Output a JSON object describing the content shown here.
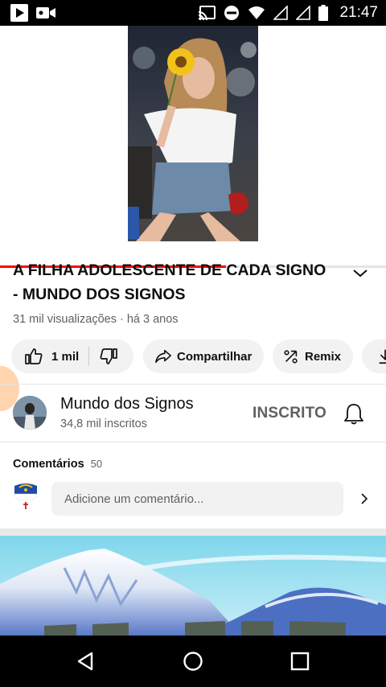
{
  "status_bar": {
    "time": "21:47",
    "left_icons": [
      "youtube-play-icon",
      "video-camera-icon"
    ],
    "right_icons": [
      "cast-icon",
      "do-not-disturb-icon",
      "wifi-icon",
      "signal-icon",
      "signal-icon",
      "battery-icon"
    ]
  },
  "video": {
    "progress_fraction": 0.585
  },
  "title": {
    "line1": "A FILHA ADOLESCENTE DE CADA SIGNO",
    "line2": "- MUNDO DOS SIGNOS"
  },
  "meta": "31 mil visualizações · há 3 anos",
  "actions": {
    "like_count": "1 mil",
    "share_label": "Compartilhar",
    "remix_label": "Remix"
  },
  "channel": {
    "name": "Mundo dos Signos",
    "subscribers": "34,8 mil inscritos",
    "subscribed_label": "INSCRITO"
  },
  "comments": {
    "title": "Comentários",
    "count": "50",
    "placeholder": "Adicione um comentário..."
  },
  "colors": {
    "accent": "#ff0000",
    "chip_bg": "#f2f2f2",
    "secondary_text": "#606060"
  }
}
